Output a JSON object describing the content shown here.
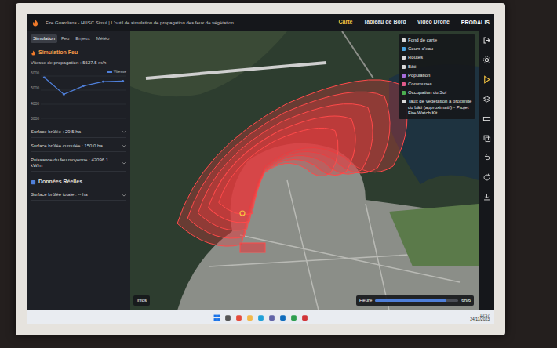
{
  "window": {
    "title": "Fire Guardians - HUSC Simul | L'outil de simulation de propagation des feux de végétation"
  },
  "nav_tabs": [
    {
      "label": "Carte",
      "selected": true
    },
    {
      "label": "Tableau de Bord",
      "selected": false
    },
    {
      "label": "Vidéo Drone",
      "selected": false
    }
  ],
  "brand": "PRODALIS",
  "panel_tabs": [
    {
      "label": "Simulation",
      "selected": true
    },
    {
      "label": "Feu",
      "selected": false
    },
    {
      "label": "Enjeux",
      "selected": false
    },
    {
      "label": "Météo",
      "selected": false
    }
  ],
  "simulation": {
    "title": "Simulation Feu",
    "speed": "Vitesse de propagation : 5627.5 m/h",
    "chart": {
      "legend": "Vitesse",
      "ticks": [
        "6000",
        "5000",
        "4000",
        "3000"
      ],
      "values": [
        5900,
        4700,
        5300,
        5600,
        5650
      ]
    },
    "stats": [
      "Surface brûlée : 29.5 ha",
      "Surface brûlée cumulée : 150.0 ha",
      "Puissance du feu moyenne : 42096.1 kW/m"
    ]
  },
  "real_data": {
    "title": "Données Réelles",
    "stats": [
      "Surface brûlée totale : -- ha"
    ]
  },
  "layers": [
    {
      "label": "Fond de carte",
      "color": "#d9d9d9"
    },
    {
      "label": "Cours d'eau",
      "color": "#4aa3df"
    },
    {
      "label": "Routes",
      "color": "#d9d9d9"
    },
    {
      "label": "Bâti",
      "color": "#d9d9d9"
    },
    {
      "label": "Population",
      "color": "#a66cd9"
    },
    {
      "label": "Communes",
      "color": "#e05a8a"
    },
    {
      "label": "Occupation du Sol",
      "color": "#4caf50"
    },
    {
      "label": "Taux de végétation à proximité du bâti (approximatif) - Projet Fire Watch Kit",
      "color": "#d9d9d9"
    }
  ],
  "map_button": "Infos",
  "timeline": {
    "label": "Heure",
    "value": "6h/6",
    "level": 0.86
  },
  "taskbar": {
    "time": "10:57",
    "date": "24/11/2023"
  }
}
